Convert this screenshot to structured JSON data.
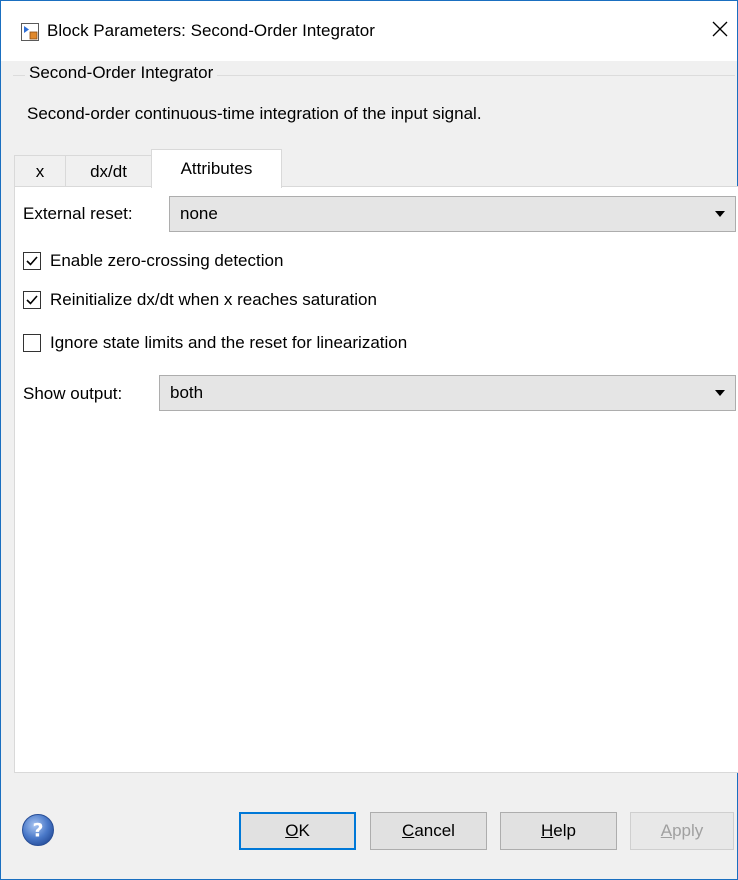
{
  "window": {
    "title": "Block Parameters: Second-Order Integrator"
  },
  "block": {
    "name": "Second-Order Integrator",
    "description": "Second-order continuous-time integration of the input signal."
  },
  "tabs": [
    {
      "label": "x",
      "active": false
    },
    {
      "label": "dx/dt",
      "active": false
    },
    {
      "label": "Attributes",
      "active": true
    }
  ],
  "attributes": {
    "external_reset": {
      "label": "External reset:",
      "value": "none"
    },
    "checkboxes": [
      {
        "label": "Enable zero-crossing detection",
        "checked": true
      },
      {
        "label": "Reinitialize dx/dt when x reaches saturation",
        "checked": true
      },
      {
        "label": "Ignore state limits and the reset for linearization",
        "checked": false
      }
    ],
    "show_output": {
      "label": "Show output:",
      "value": "both"
    }
  },
  "buttons": {
    "ok": {
      "mnemonic": "O",
      "rest": "K"
    },
    "cancel": {
      "mnemonic": "C",
      "rest": "ancel"
    },
    "help": {
      "mnemonic": "H",
      "rest": "elp"
    },
    "apply": {
      "mnemonic": "A",
      "rest": "pply",
      "enabled": false
    }
  },
  "icons": {
    "app": "simulink-block-icon",
    "close": "close-icon",
    "help": "help-circle-icon",
    "dropdown": "chevron-down-icon",
    "check": "checkmark-icon"
  },
  "colors": {
    "window_border": "#1a6fc0",
    "default_button_border": "#0078d7",
    "help_icon": "#4a79c9"
  }
}
